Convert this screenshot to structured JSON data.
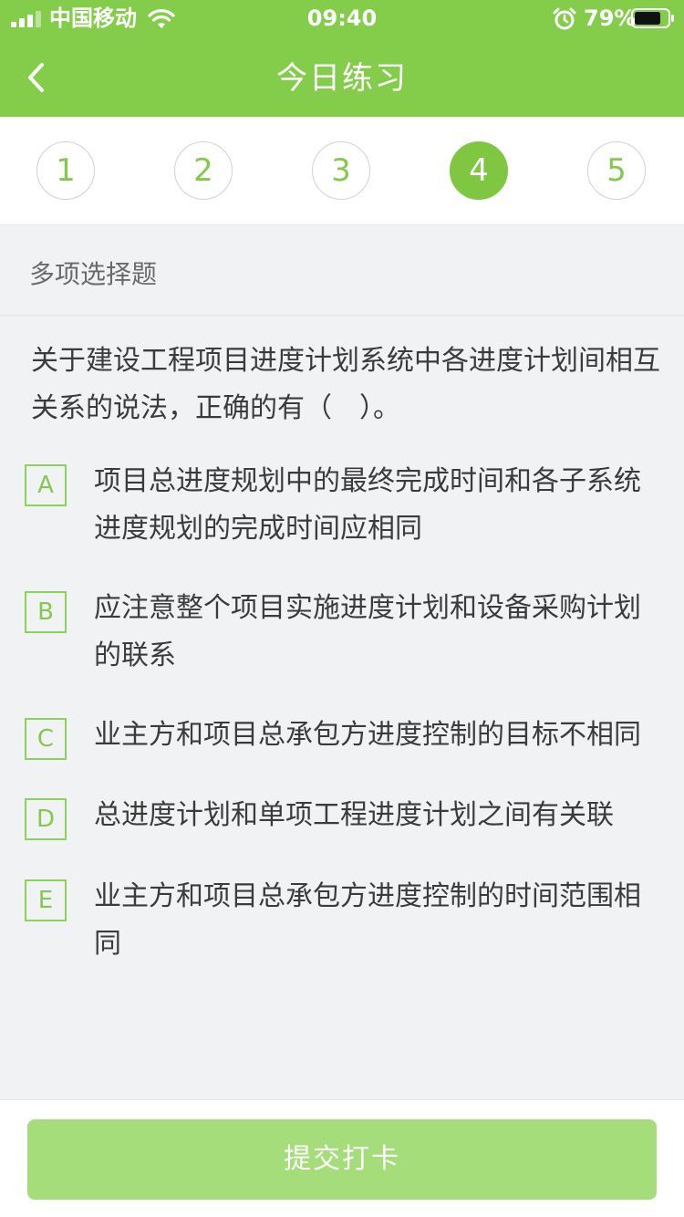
{
  "status_bar": {
    "carrier": "中国移动",
    "time": "09:40",
    "battery": "79%",
    "icons": [
      "signal-icon",
      "wifi-icon",
      "alarm-icon",
      "battery-icon"
    ]
  },
  "nav": {
    "title": "今日练习",
    "back_icon": "chevron-left-icon"
  },
  "question_nav": {
    "items": [
      "1",
      "2",
      "3",
      "4",
      "5"
    ],
    "current": "4"
  },
  "question": {
    "type": "多项选择题",
    "stem": "关于建设工程项目进度计划系统中各进度计划间相互关系的说法，正确的有（　）。",
    "options": [
      {
        "key": "A",
        "text": "项目总进度规划中的最终完成时间和各子系统进度规划的完成时间应相同"
      },
      {
        "key": "B",
        "text": "应注意整个项目实施进度计划和设备采购计划的联系"
      },
      {
        "key": "C",
        "text": "业主方和项目总承包方进度控制的目标不相同"
      },
      {
        "key": "D",
        "text": "总进度计划和单项工程进度计划之间有关联"
      },
      {
        "key": "E",
        "text": "业主方和项目总承包方进度控制的时间范围相同"
      }
    ]
  },
  "footer": {
    "submit_label": "提交打卡"
  },
  "colors": {
    "header_green": "#84cd4b",
    "accent_green": "#7fc741",
    "submit_disabled": "#a5dd7a",
    "background": "#f1f2f4",
    "text": "#3b3b3b"
  }
}
